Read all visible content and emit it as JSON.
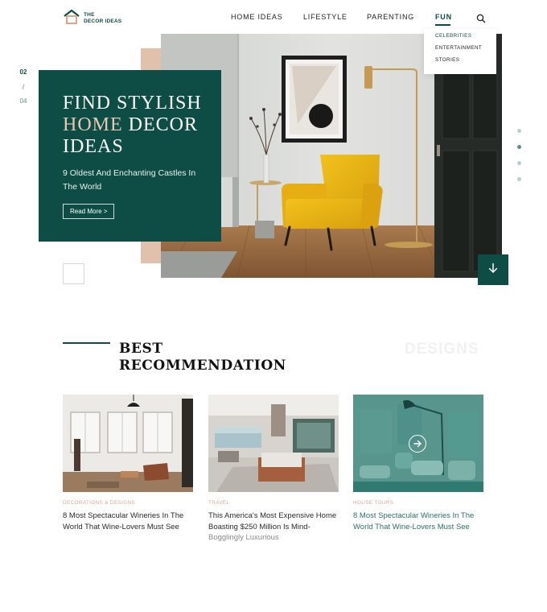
{
  "brand": {
    "line1": "THE",
    "line2": "DECOR IDEAS"
  },
  "nav": {
    "items": [
      "HOME IDEAS",
      "LIFESTYLE",
      "PARENTING",
      "FUN"
    ],
    "active": "FUN",
    "dropdown": [
      "CELEBRITIES",
      "ENTERTAINMENT",
      "STORIES"
    ]
  },
  "hero": {
    "counter": {
      "current": "02",
      "separator": "/",
      "total": "04"
    },
    "title_line1": "FIND STYLISH",
    "title_accent": "HOME",
    "title_rest": " DECOR",
    "title_line3": "IDEAS",
    "subtitle": "9 Oldest And Enchanting Castles In The World",
    "cta": "Read More >",
    "slide_count": 4,
    "active_slide": 2
  },
  "recommendations": {
    "title_line1": "BEST",
    "title_line2": "RECOMMENDATION",
    "watermark": "DESIGNS",
    "cards": [
      {
        "category": "DECORATIONS & DESIGNS",
        "title": "8 Most Spectacular Wineries In The World That Wine-Lovers Must See",
        "title_rest": ""
      },
      {
        "category": "TRAVEL",
        "title": "This America's Most Expensive Home Boasting $250 Million Is Mind-",
        "title_rest": "Bogglingly Luxurious"
      },
      {
        "category": "HOUSE TOURS",
        "title": "8 Most Spectacular Wineries In The World That Wine-Lovers Must See",
        "title_rest": ""
      }
    ]
  },
  "colors": {
    "primary": "#0e4d45",
    "accent": "#e1c0ac",
    "card_teal": "#2e6e66"
  },
  "icons": [
    "house-logo-icon",
    "search-icon",
    "arrow-down-icon",
    "arrow-right-icon"
  ]
}
